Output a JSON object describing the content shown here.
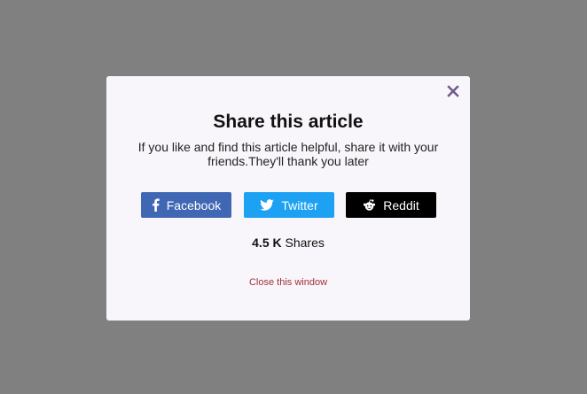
{
  "modal": {
    "title": "Share this article",
    "description": "If you like and find this article helpful, share it with your friends.They'll thank you later",
    "close_icon": "close-icon",
    "buttons": {
      "facebook": {
        "label": "Facebook",
        "icon": "facebook-icon",
        "color": "#4067b3"
      },
      "twitter": {
        "label": "Twitter",
        "icon": "twitter-icon",
        "color": "#1da1f2"
      },
      "reddit": {
        "label": "Reddit",
        "icon": "reddit-icon",
        "color": "#000000"
      }
    },
    "shares": {
      "count": "4.5 K",
      "label": "Shares"
    },
    "close_link": "Close this window"
  },
  "colors": {
    "overlay": "#808080",
    "modal_bg": "#f8f6fa",
    "close_icon": "#6e5a8a",
    "close_link": "#a0303a"
  }
}
